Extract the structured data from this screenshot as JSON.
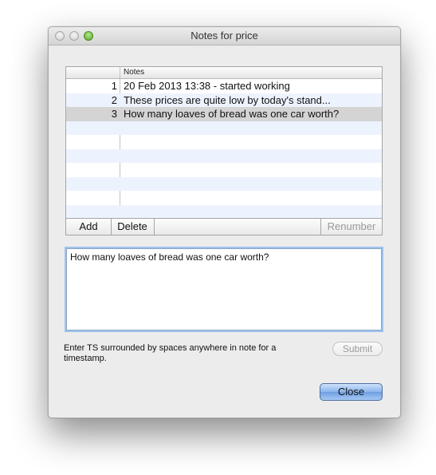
{
  "window": {
    "title": "Notes for price"
  },
  "table": {
    "header": {
      "notes_label": "Notes"
    },
    "rows": [
      {
        "num": "1",
        "note": "20 Feb 2013 13:38 - started working"
      },
      {
        "num": "2",
        "note": "These prices are quite low by today's stand..."
      },
      {
        "num": "3",
        "note": "How many loaves of bread was one car worth?"
      }
    ],
    "selected_row": 3
  },
  "buttons": {
    "add": "Add",
    "delete": "Delete",
    "renumber": "Renumber",
    "submit": "Submit",
    "close": "Close"
  },
  "editor": {
    "value": "How many loaves of bread was one car worth?"
  },
  "hint": "Enter TS surrounded by spaces anywhere in note for a timestamp."
}
